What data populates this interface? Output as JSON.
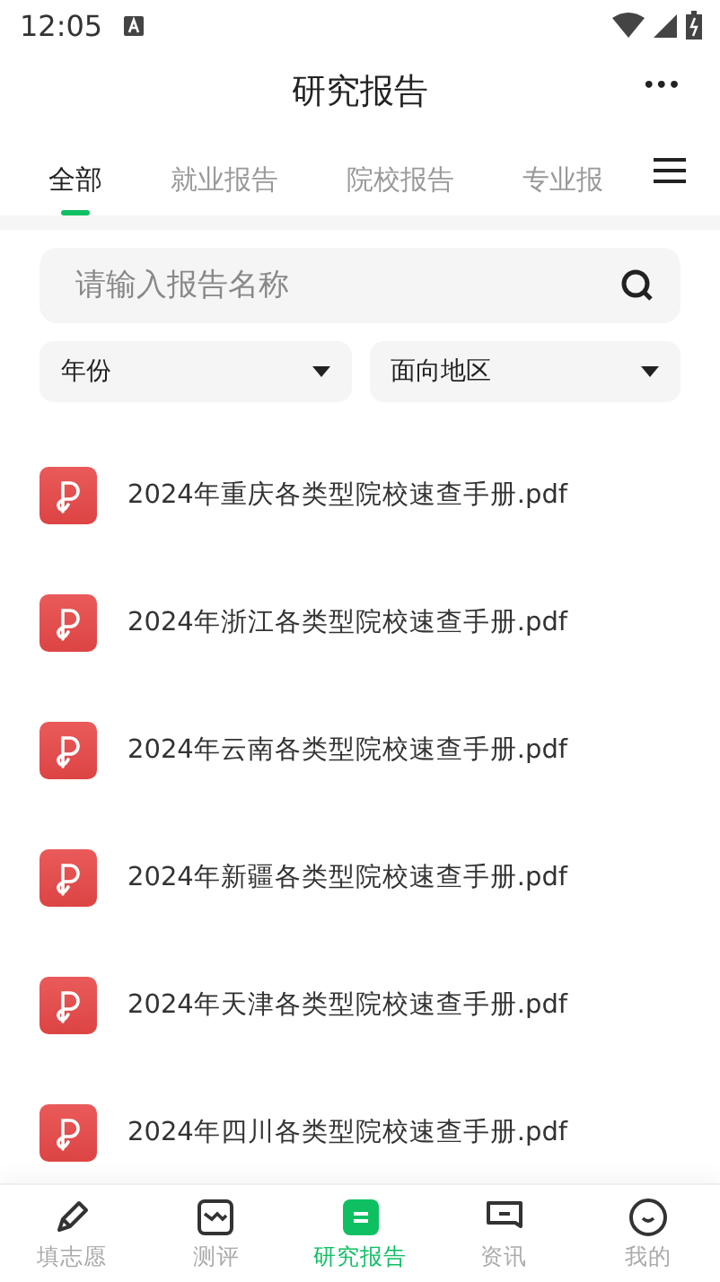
{
  "status_bar": {
    "time": "12:05"
  },
  "header": {
    "title": "研究报告",
    "more": "•••"
  },
  "tabs": [
    {
      "label": "全部",
      "selected": true
    },
    {
      "label": "就业报告",
      "selected": false
    },
    {
      "label": "院校报告",
      "selected": false
    },
    {
      "label": "专业报",
      "selected": false
    }
  ],
  "search": {
    "placeholder": "请输入报告名称"
  },
  "filters": [
    {
      "label": "年份"
    },
    {
      "label": "面向地区"
    }
  ],
  "files": [
    {
      "name": "2024年重庆各类型院校速查手册.pdf"
    },
    {
      "name": "2024年浙江各类型院校速查手册.pdf"
    },
    {
      "name": "2024年云南各类型院校速查手册.pdf"
    },
    {
      "name": "2024年新疆各类型院校速查手册.pdf"
    },
    {
      "name": "2024年天津各类型院校速查手册.pdf"
    },
    {
      "name": "2024年四川各类型院校速查手册.pdf"
    }
  ],
  "bottom_nav": [
    {
      "label": "填志愿",
      "selected": false,
      "kind": "pen"
    },
    {
      "label": "测评",
      "selected": false,
      "kind": "chart"
    },
    {
      "label": "研究报告",
      "selected": true,
      "kind": "report"
    },
    {
      "label": "资讯",
      "selected": false,
      "kind": "chat"
    },
    {
      "label": "我的",
      "selected": false,
      "kind": "smile"
    }
  ]
}
